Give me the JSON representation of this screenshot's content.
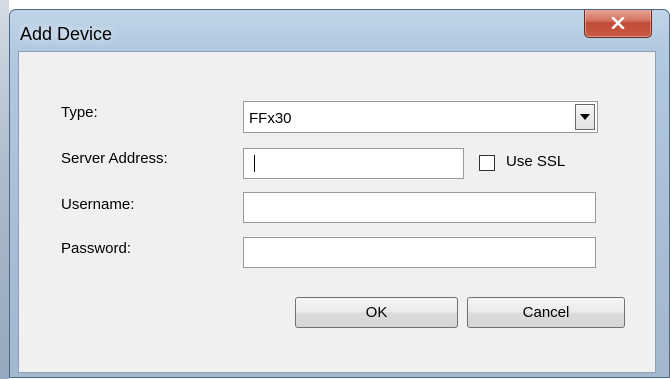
{
  "window": {
    "title": "Add Device",
    "close_icon": "close-icon"
  },
  "form": {
    "type": {
      "label": "Type:",
      "selected": "FFx30"
    },
    "server_address": {
      "label": "Server Address:",
      "value": ""
    },
    "use_ssl": {
      "label": "Use SSL",
      "checked": false
    },
    "username": {
      "label": "Username:",
      "value": ""
    },
    "password": {
      "label": "Password:",
      "value": ""
    }
  },
  "buttons": {
    "ok": "OK",
    "cancel": "Cancel"
  },
  "colors": {
    "title_bar": "#b0c8e0",
    "close_button": "#c85a44",
    "client_background": "#f0f0f0"
  }
}
